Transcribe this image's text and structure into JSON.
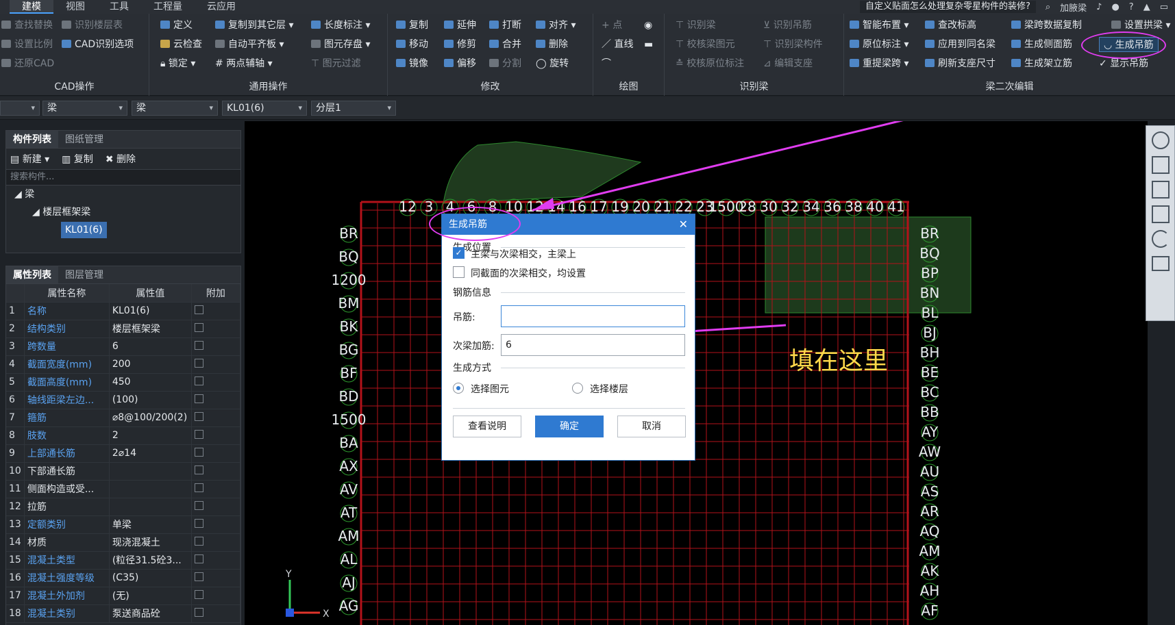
{
  "menubar": {
    "tabs": [
      "建模",
      "视图",
      "工具",
      "工程量",
      "云应用"
    ],
    "hint": "自定义贴面怎么处理复杂零星构件的装修?",
    "user": "加腋梁"
  },
  "ribbon": {
    "cad": {
      "rows": [
        "查找替换",
        "识别楼层表",
        "设置比例",
        "CAD识别选项",
        "还原CAD"
      ],
      "caption": "CAD操作"
    },
    "common": {
      "r1": [
        "定义",
        "复制到其它层",
        "长度标注"
      ],
      "r2": [
        "云检查",
        "自动平齐板",
        "图元存盘"
      ],
      "r3": [
        "锁定",
        "两点辅轴",
        "图元过滤"
      ],
      "caption": "通用操作"
    },
    "modify": {
      "r1": [
        "复制",
        "延伸",
        "打断",
        "对齐"
      ],
      "r2": [
        "移动",
        "修剪",
        "合并",
        "删除"
      ],
      "r3": [
        "镜像",
        "偏移",
        "分割",
        "旋转"
      ],
      "caption": "修改"
    },
    "draw": {
      "r1": [
        "点"
      ],
      "r2": [
        "直线"
      ],
      "caption": "绘图"
    },
    "identify": {
      "r1": [
        "识别梁",
        "识别吊筋"
      ],
      "r2": [
        "校核梁图元",
        "识别梁构件"
      ],
      "r3": [
        "校核原位标注",
        "编辑支座"
      ],
      "caption": "识别梁"
    },
    "edit": {
      "r1": [
        "智能布置",
        "查改标高",
        "梁跨数据复制",
        "设置拱梁"
      ],
      "r2": [
        "原位标注",
        "应用到同名梁",
        "生成侧面筋",
        "生成吊筋"
      ],
      "r3": [
        "重提梁跨",
        "刷新支座尺寸",
        "生成架立筋",
        "显示吊筋"
      ],
      "caption": "梁二次编辑"
    }
  },
  "selectors": [
    "梁",
    "梁",
    "KL01(6)",
    "分层1"
  ],
  "component_panel": {
    "tabs": [
      "构件列表",
      "图纸管理"
    ],
    "actions": [
      "新建",
      "复制",
      "删除"
    ],
    "search_placeholder": "搜索构件...",
    "tree": [
      "梁",
      "楼层框架梁",
      "KL01(6)"
    ]
  },
  "property_panel": {
    "tabs": [
      "属性列表",
      "图层管理"
    ],
    "headers": [
      "属性名称",
      "属性值",
      "附加"
    ],
    "rows": [
      {
        "n": "1",
        "name": "名称",
        "value": "KL01(6)"
      },
      {
        "n": "2",
        "name": "结构类别",
        "value": "楼层框架梁"
      },
      {
        "n": "3",
        "name": "跨数量",
        "value": "6"
      },
      {
        "n": "4",
        "name": "截面宽度(mm)",
        "value": "200"
      },
      {
        "n": "5",
        "name": "截面高度(mm)",
        "value": "450"
      },
      {
        "n": "6",
        "name": "轴线距梁左边...",
        "value": "(100)"
      },
      {
        "n": "7",
        "name": "箍筋",
        "value": "⌀8@100/200(2)"
      },
      {
        "n": "8",
        "name": "肢数",
        "value": "2"
      },
      {
        "n": "9",
        "name": "上部通长筋",
        "value": "2⌀14"
      },
      {
        "n": "10",
        "name": "下部通长筋",
        "value": ""
      },
      {
        "n": "11",
        "name": "侧面构造或受...",
        "value": ""
      },
      {
        "n": "12",
        "name": "拉筋",
        "value": ""
      },
      {
        "n": "13",
        "name": "定额类别",
        "value": "单梁"
      },
      {
        "n": "14",
        "name": "材质",
        "value": "现浇混凝土"
      },
      {
        "n": "15",
        "name": "混凝土类型",
        "value": "(粒径31.5砼3..."
      },
      {
        "n": "16",
        "name": "混凝土强度等级",
        "value": "(C35)"
      },
      {
        "n": "17",
        "name": "混凝土外加剂",
        "value": "(无)"
      },
      {
        "n": "18",
        "name": "混凝土类别",
        "value": "泵送商品砼"
      }
    ]
  },
  "canvas": {
    "top_axis": [
      "12",
      "3",
      "4",
      "6",
      "8",
      "10",
      "12",
      "14",
      "16",
      "17",
      "19",
      "20",
      "21",
      "22",
      "23",
      "1500",
      "28",
      "30",
      "32",
      "34",
      "36",
      "38",
      "40",
      "41"
    ],
    "left_axis": [
      "BR",
      "BQ",
      "1200",
      "BM",
      "BK",
      "BG",
      "BF",
      "BD",
      "1500",
      "BA",
      "AX",
      "AV",
      "AT",
      "AM",
      "AL",
      "AJ",
      "AG"
    ],
    "right_axis": [
      "BR",
      "BQ",
      "BP",
      "BN",
      "BL",
      "BJ",
      "BH",
      "BE",
      "BC",
      "BB",
      "AY",
      "AW",
      "AU",
      "AS",
      "AR",
      "AQ",
      "AM",
      "AK",
      "AH",
      "AF"
    ],
    "annotation": "填在这里",
    "axis_x": "X",
    "axis_y": "Y"
  },
  "dialog": {
    "title": "生成吊筋",
    "section_position": "生成位置",
    "opt1": "主梁与次梁相交，主梁上",
    "opt2": "同截面的次梁相交，均设置",
    "section_rebar": "钢筋信息",
    "label_hanger": "吊筋:",
    "hanger_value": "",
    "label_secondary": "次梁加筋:",
    "secondary_value": "6",
    "section_method": "生成方式",
    "radio1": "选择图元",
    "radio2": "选择楼层",
    "btn_help": "查看说明",
    "btn_ok": "确定",
    "btn_cancel": "取消"
  },
  "colors": {
    "accent": "#2f7ad1",
    "highlight": "#e03cf0",
    "grid": "#b3121a",
    "annotation": "#ffd94a"
  }
}
